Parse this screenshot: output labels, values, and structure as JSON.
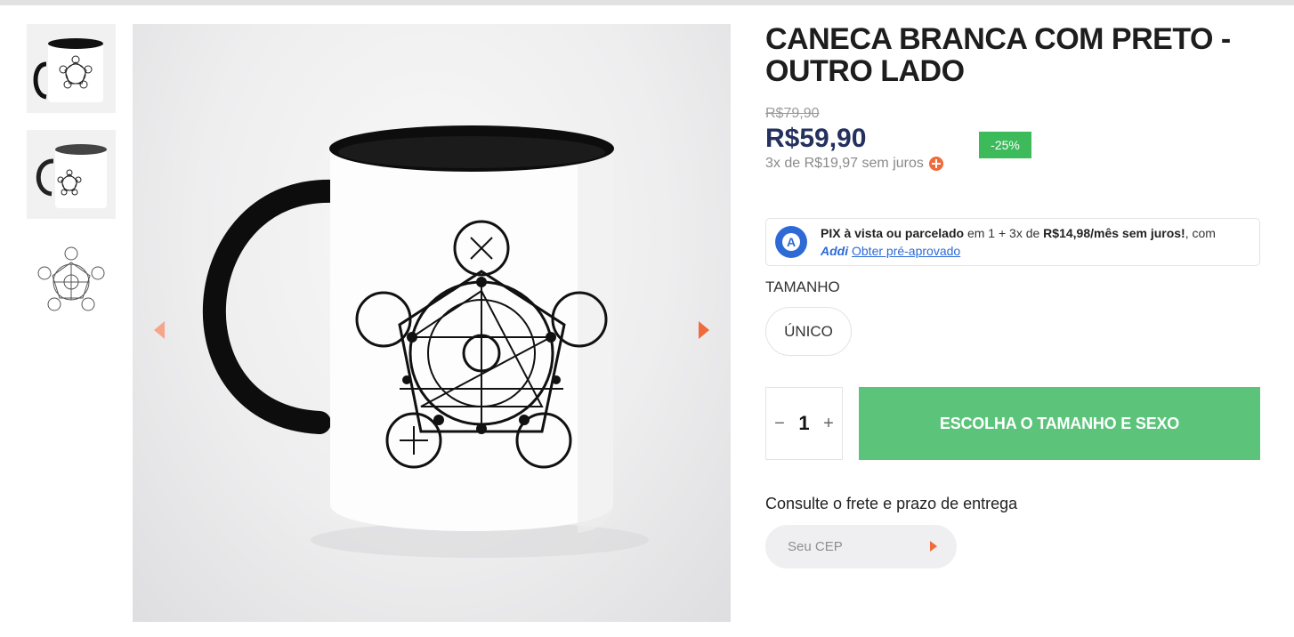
{
  "product": {
    "title": "CANECA BRANCA COM PRETO - OUTRO LADO",
    "old_price": "R$79,90",
    "price": "R$59,90",
    "discount": "-25%",
    "installments": "3x de R$19,97 sem juros"
  },
  "addi": {
    "lead_bold": "PIX à vista ou parcelado",
    "mid": " em 1 + 3x de ",
    "amount_bold": "R$14,98/mês sem juros!",
    "tail": ", com",
    "brand": "Addi",
    "link": "Obter pré-aprovado",
    "logo_letter": "A"
  },
  "size": {
    "label": "TAMANHO",
    "options": [
      "ÚNICO"
    ]
  },
  "quantity": {
    "minus": "−",
    "value": "1",
    "plus": "+"
  },
  "buy_button": "ESCOLHA O TAMANHO E SEXO",
  "shipping": {
    "label": "Consulte o frete e prazo de entrega",
    "placeholder": "Seu CEP"
  },
  "gallery": {
    "thumbnails": [
      "mug-front-thumbnail",
      "mug-side-thumbnail",
      "print-art-thumbnail"
    ],
    "arrows": [
      "arrow-left-icon",
      "arrow-right-icon"
    ]
  },
  "colors": {
    "accent_orange": "#f06a3a",
    "price_navy": "#24305e",
    "discount_green": "#3dbb5b",
    "buy_green": "#5bc47a",
    "addi_blue": "#2d6ad6"
  }
}
